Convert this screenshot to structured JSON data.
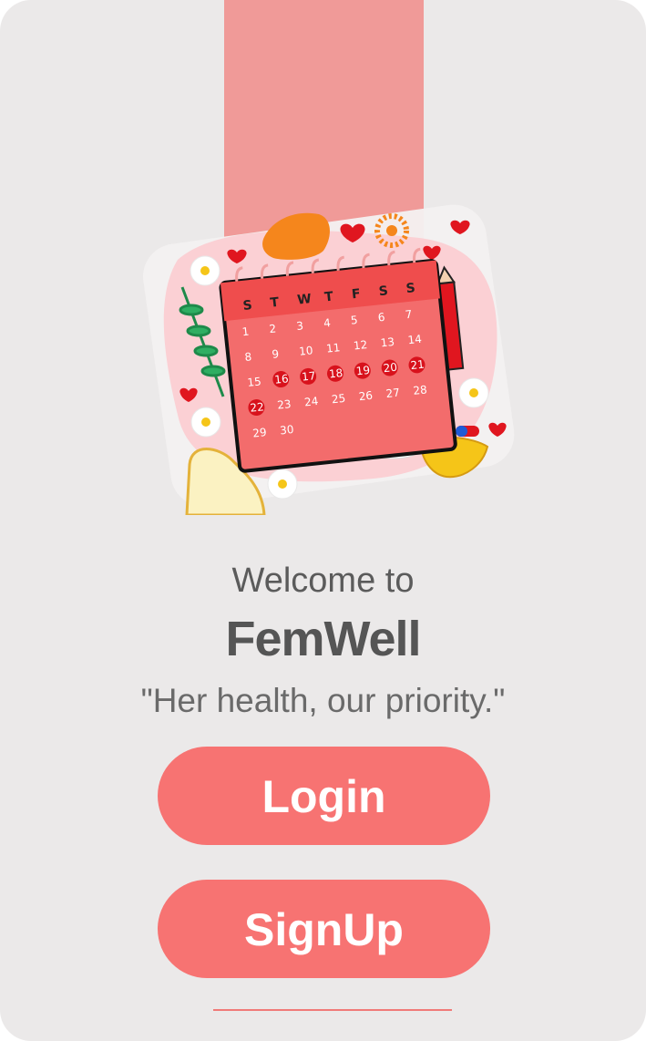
{
  "welcome": {
    "greeting": "Welcome to",
    "app_name": "FemWell",
    "tagline": "\"Her health, our priority.\""
  },
  "actions": {
    "login_label": "Login",
    "signup_label": "SignUp"
  },
  "calendar": {
    "weekdays": [
      "S",
      "T",
      "W",
      "T",
      "F",
      "S",
      "S"
    ],
    "days": [
      [
        "1",
        "2",
        "3",
        "4",
        "5",
        "6",
        "7"
      ],
      [
        "8",
        "9",
        "10",
        "11",
        "12",
        "13",
        "14"
      ],
      [
        "15",
        "16",
        "17",
        "18",
        "19",
        "20",
        "21"
      ],
      [
        "22",
        "23",
        "24",
        "25",
        "26",
        "27",
        "28"
      ],
      [
        "29",
        "30"
      ]
    ],
    "highlighted_days": [
      "16",
      "17",
      "18",
      "19",
      "20",
      "21",
      "22"
    ]
  },
  "colors": {
    "accent": "#f77372",
    "background": "#ebe9e9",
    "band": "#f09a98",
    "text": "#555555"
  }
}
